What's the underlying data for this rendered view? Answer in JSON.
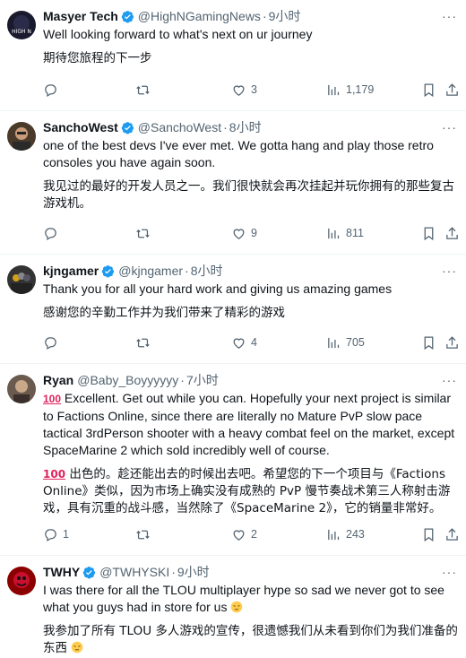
{
  "tweets": [
    {
      "name": "Masyer Tech",
      "handle": "@HighNGamingNews",
      "time": "9小时",
      "verified": true,
      "text": "Well looking forward to what's next on ur journey",
      "translation": "期待您旅程的下一步",
      "replies": "",
      "retweets": "",
      "likes": "3",
      "views": "1,179"
    },
    {
      "name": "SanchoWest",
      "handle": "@SanchoWest",
      "time": "8小时",
      "verified": true,
      "text": "one of the best devs I've ever met. We gotta hang and play those retro consoles you have again soon.",
      "translation": "我见过的最好的开发人员之一。我们很快就会再次挂起并玩你拥有的那些复古游戏机。",
      "replies": "",
      "retweets": "",
      "likes": "9",
      "views": "811"
    },
    {
      "name": "kjngamer",
      "handle": "@kjngamer",
      "time": "8小时",
      "verified": true,
      "text": "Thank you for all your hard work and giving us amazing games",
      "translation": "感谢您的辛勤工作并为我们带来了精彩的游戏",
      "replies": "",
      "retweets": "",
      "likes": "4",
      "views": "705"
    },
    {
      "name": "Ryan",
      "handle": "@Baby_Boyyyyyy",
      "time": "7小时",
      "verified": false,
      "text": "Excellent. Get out while you can. Hopefully your next project is similar to Factions Online, since there are literally no Mature PvP slow pace tactical 3rdPerson shooter with a heavy combat feel on the market, except SpaceMarine 2 which sold incredibly well of course.",
      "translation": "出色的。趁还能出去的时候出去吧。希望您的下一个项目与《Factions Online》类似，因为市场上确实没有成熟的 PvP 慢节奏战术第三人称射击游戏，具有沉重的战斗感，当然除了《SpaceMarine 2》，它的销量非常好。",
      "emoji": "100",
      "replies": "1",
      "retweets": "",
      "likes": "2",
      "views": "243"
    },
    {
      "name": "TWHY",
      "handle": "@TWHYSKI",
      "time": "9小时",
      "verified": true,
      "text": "I was there for all the TLOU multiplayer hype so sad we never got to see what you guys had in store for us",
      "translation": "我参加了所有 TLOU 多人游戏的宣传，很遗憾我们从未看到你们为我们准备的东西",
      "replies": "",
      "retweets": "",
      "likes": "",
      "views": ""
    }
  ],
  "colors": {
    "verified": "#1d9bf0",
    "secondary": "#536471",
    "divider": "#eff3f4"
  }
}
